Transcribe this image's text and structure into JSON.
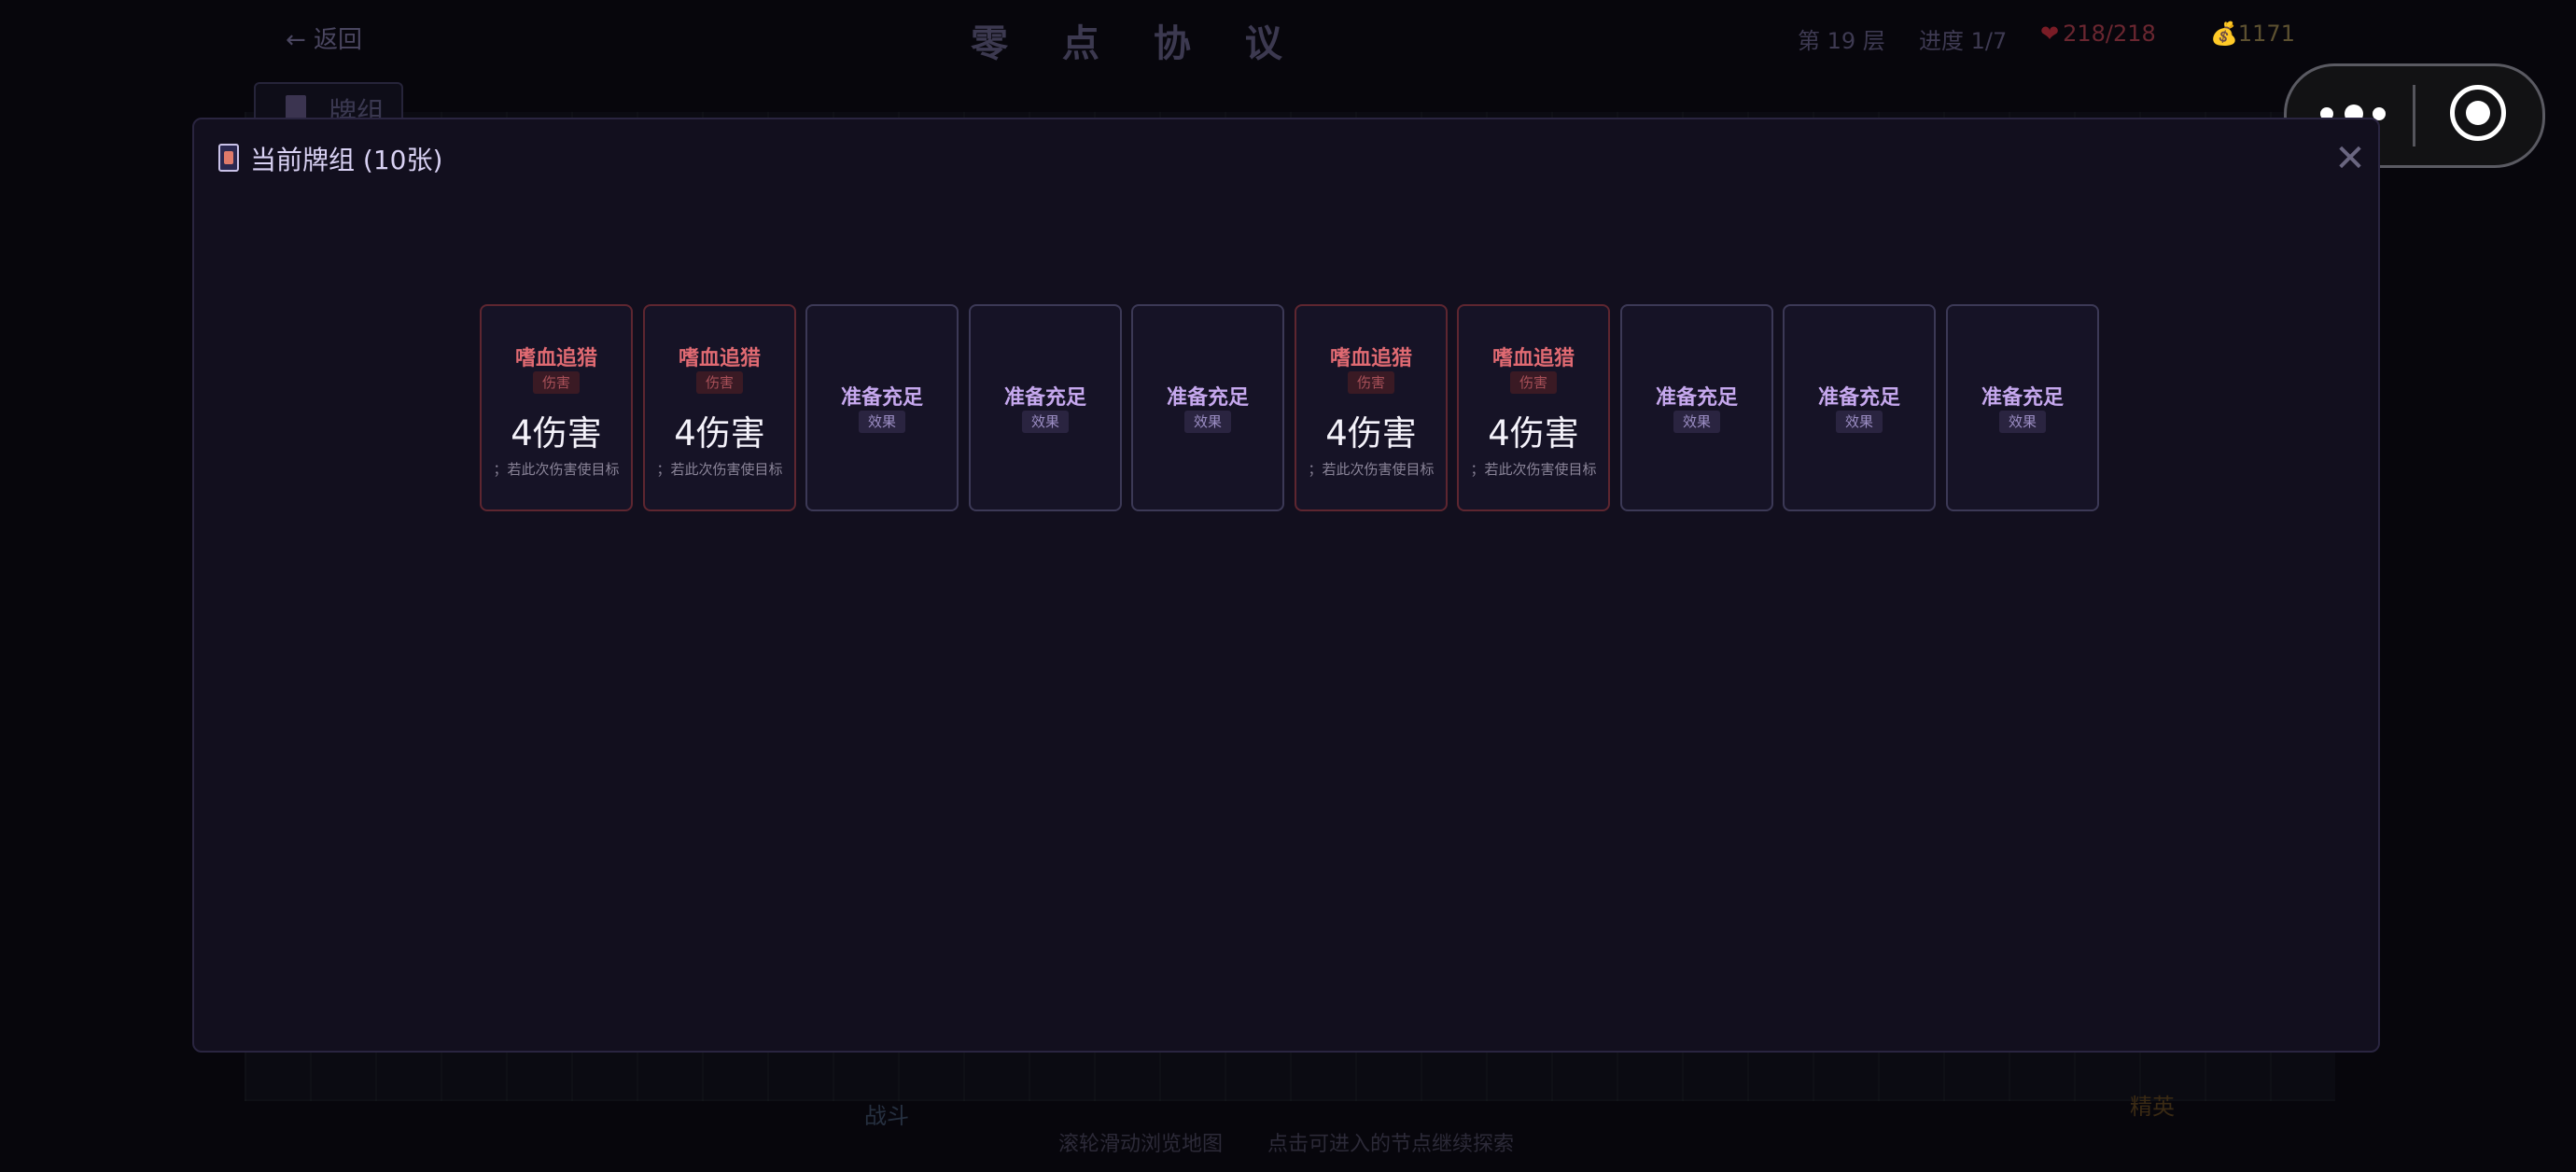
{
  "header": {
    "back_label": "← 返回",
    "title": "零 点 协 议",
    "floor": "第 19 层",
    "progress": "进度 1/7",
    "hp": "218/218",
    "gold": "1171",
    "deck_tab_label": "牌组"
  },
  "map": {
    "bottom_hint_1": "滚轮滑动浏览地图",
    "bottom_hint_2": "点击可进入的节点继续探索",
    "node_elite_label": "精英",
    "node_battle_label": "战斗"
  },
  "modal": {
    "title": "当前牌组 (10张)",
    "close_icon": "close-icon"
  },
  "cards": [
    {
      "name": "嗜血追猎",
      "type": "伤害",
      "value": "4伤害",
      "desc": "；若此次伤害使目标",
      "kind": "attack"
    },
    {
      "name": "嗜血追猎",
      "type": "伤害",
      "value": "4伤害",
      "desc": "；若此次伤害使目标",
      "kind": "attack"
    },
    {
      "name": "准备充足",
      "type": "效果",
      "value": "",
      "desc": "",
      "kind": "skill"
    },
    {
      "name": "准备充足",
      "type": "效果",
      "value": "",
      "desc": "",
      "kind": "skill"
    },
    {
      "name": "准备充足",
      "type": "效果",
      "value": "",
      "desc": "",
      "kind": "skill"
    },
    {
      "name": "嗜血追猎",
      "type": "伤害",
      "value": "4伤害",
      "desc": "；若此次伤害使目标",
      "kind": "attack"
    },
    {
      "name": "嗜血追猎",
      "type": "伤害",
      "value": "4伤害",
      "desc": "；若此次伤害使目标",
      "kind": "attack"
    },
    {
      "name": "准备充足",
      "type": "效果",
      "value": "",
      "desc": "",
      "kind": "skill"
    },
    {
      "name": "准备充足",
      "type": "效果",
      "value": "",
      "desc": "",
      "kind": "skill"
    },
    {
      "name": "准备充足",
      "type": "效果",
      "value": "",
      "desc": "",
      "kind": "skill"
    }
  ],
  "colors": {
    "attack_accent": "#e06a72",
    "skill_accent": "#c6a8ee",
    "modal_bg": "#120f1e"
  }
}
